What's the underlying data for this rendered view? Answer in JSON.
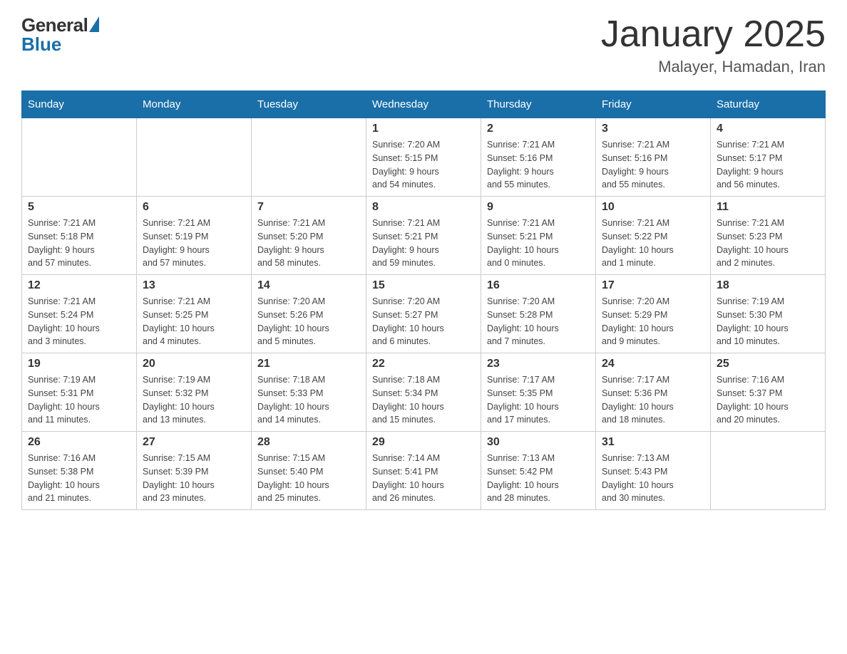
{
  "header": {
    "logo_general": "General",
    "logo_blue": "Blue",
    "month_title": "January 2025",
    "location": "Malayer, Hamadan, Iran"
  },
  "days_of_week": [
    "Sunday",
    "Monday",
    "Tuesday",
    "Wednesday",
    "Thursday",
    "Friday",
    "Saturday"
  ],
  "weeks": [
    [
      {
        "day": "",
        "info": ""
      },
      {
        "day": "",
        "info": ""
      },
      {
        "day": "",
        "info": ""
      },
      {
        "day": "1",
        "info": "Sunrise: 7:20 AM\nSunset: 5:15 PM\nDaylight: 9 hours\nand 54 minutes."
      },
      {
        "day": "2",
        "info": "Sunrise: 7:21 AM\nSunset: 5:16 PM\nDaylight: 9 hours\nand 55 minutes."
      },
      {
        "day": "3",
        "info": "Sunrise: 7:21 AM\nSunset: 5:16 PM\nDaylight: 9 hours\nand 55 minutes."
      },
      {
        "day": "4",
        "info": "Sunrise: 7:21 AM\nSunset: 5:17 PM\nDaylight: 9 hours\nand 56 minutes."
      }
    ],
    [
      {
        "day": "5",
        "info": "Sunrise: 7:21 AM\nSunset: 5:18 PM\nDaylight: 9 hours\nand 57 minutes."
      },
      {
        "day": "6",
        "info": "Sunrise: 7:21 AM\nSunset: 5:19 PM\nDaylight: 9 hours\nand 57 minutes."
      },
      {
        "day": "7",
        "info": "Sunrise: 7:21 AM\nSunset: 5:20 PM\nDaylight: 9 hours\nand 58 minutes."
      },
      {
        "day": "8",
        "info": "Sunrise: 7:21 AM\nSunset: 5:21 PM\nDaylight: 9 hours\nand 59 minutes."
      },
      {
        "day": "9",
        "info": "Sunrise: 7:21 AM\nSunset: 5:21 PM\nDaylight: 10 hours\nand 0 minutes."
      },
      {
        "day": "10",
        "info": "Sunrise: 7:21 AM\nSunset: 5:22 PM\nDaylight: 10 hours\nand 1 minute."
      },
      {
        "day": "11",
        "info": "Sunrise: 7:21 AM\nSunset: 5:23 PM\nDaylight: 10 hours\nand 2 minutes."
      }
    ],
    [
      {
        "day": "12",
        "info": "Sunrise: 7:21 AM\nSunset: 5:24 PM\nDaylight: 10 hours\nand 3 minutes."
      },
      {
        "day": "13",
        "info": "Sunrise: 7:21 AM\nSunset: 5:25 PM\nDaylight: 10 hours\nand 4 minutes."
      },
      {
        "day": "14",
        "info": "Sunrise: 7:20 AM\nSunset: 5:26 PM\nDaylight: 10 hours\nand 5 minutes."
      },
      {
        "day": "15",
        "info": "Sunrise: 7:20 AM\nSunset: 5:27 PM\nDaylight: 10 hours\nand 6 minutes."
      },
      {
        "day": "16",
        "info": "Sunrise: 7:20 AM\nSunset: 5:28 PM\nDaylight: 10 hours\nand 7 minutes."
      },
      {
        "day": "17",
        "info": "Sunrise: 7:20 AM\nSunset: 5:29 PM\nDaylight: 10 hours\nand 9 minutes."
      },
      {
        "day": "18",
        "info": "Sunrise: 7:19 AM\nSunset: 5:30 PM\nDaylight: 10 hours\nand 10 minutes."
      }
    ],
    [
      {
        "day": "19",
        "info": "Sunrise: 7:19 AM\nSunset: 5:31 PM\nDaylight: 10 hours\nand 11 minutes."
      },
      {
        "day": "20",
        "info": "Sunrise: 7:19 AM\nSunset: 5:32 PM\nDaylight: 10 hours\nand 13 minutes."
      },
      {
        "day": "21",
        "info": "Sunrise: 7:18 AM\nSunset: 5:33 PM\nDaylight: 10 hours\nand 14 minutes."
      },
      {
        "day": "22",
        "info": "Sunrise: 7:18 AM\nSunset: 5:34 PM\nDaylight: 10 hours\nand 15 minutes."
      },
      {
        "day": "23",
        "info": "Sunrise: 7:17 AM\nSunset: 5:35 PM\nDaylight: 10 hours\nand 17 minutes."
      },
      {
        "day": "24",
        "info": "Sunrise: 7:17 AM\nSunset: 5:36 PM\nDaylight: 10 hours\nand 18 minutes."
      },
      {
        "day": "25",
        "info": "Sunrise: 7:16 AM\nSunset: 5:37 PM\nDaylight: 10 hours\nand 20 minutes."
      }
    ],
    [
      {
        "day": "26",
        "info": "Sunrise: 7:16 AM\nSunset: 5:38 PM\nDaylight: 10 hours\nand 21 minutes."
      },
      {
        "day": "27",
        "info": "Sunrise: 7:15 AM\nSunset: 5:39 PM\nDaylight: 10 hours\nand 23 minutes."
      },
      {
        "day": "28",
        "info": "Sunrise: 7:15 AM\nSunset: 5:40 PM\nDaylight: 10 hours\nand 25 minutes."
      },
      {
        "day": "29",
        "info": "Sunrise: 7:14 AM\nSunset: 5:41 PM\nDaylight: 10 hours\nand 26 minutes."
      },
      {
        "day": "30",
        "info": "Sunrise: 7:13 AM\nSunset: 5:42 PM\nDaylight: 10 hours\nand 28 minutes."
      },
      {
        "day": "31",
        "info": "Sunrise: 7:13 AM\nSunset: 5:43 PM\nDaylight: 10 hours\nand 30 minutes."
      },
      {
        "day": "",
        "info": ""
      }
    ]
  ]
}
